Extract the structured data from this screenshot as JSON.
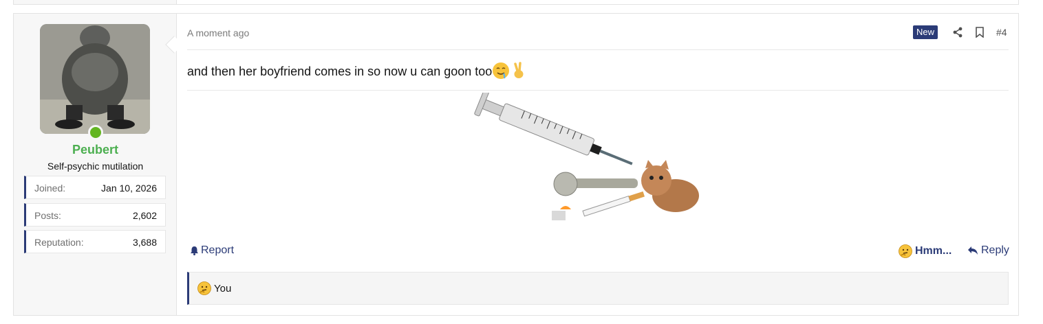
{
  "user": {
    "name": "Peubert",
    "title": "Self-psychic mutilation",
    "stats": [
      {
        "label": "Joined:",
        "value": "Jan 10, 2026"
      },
      {
        "label": "Posts:",
        "value": "2,602"
      },
      {
        "label": "Reputation:",
        "value": "3,688"
      }
    ],
    "online": true
  },
  "post": {
    "time": "A moment ago",
    "badge": "New",
    "number": "#4",
    "message": "and then her boyfriend comes in so now u can goon too",
    "message_emojis": [
      "drooling-face-emoji",
      "victory-hand-emoji"
    ],
    "attachment": "syringe-cat-gif"
  },
  "actions": {
    "report": "Report",
    "reaction": "Hmm...",
    "reply": "Reply"
  },
  "reactions": {
    "summary": "You",
    "emoji": "thinking-face-emoji"
  },
  "colors": {
    "accent": "#2b3b77",
    "username": "#4caf50",
    "online": "#63b521"
  }
}
